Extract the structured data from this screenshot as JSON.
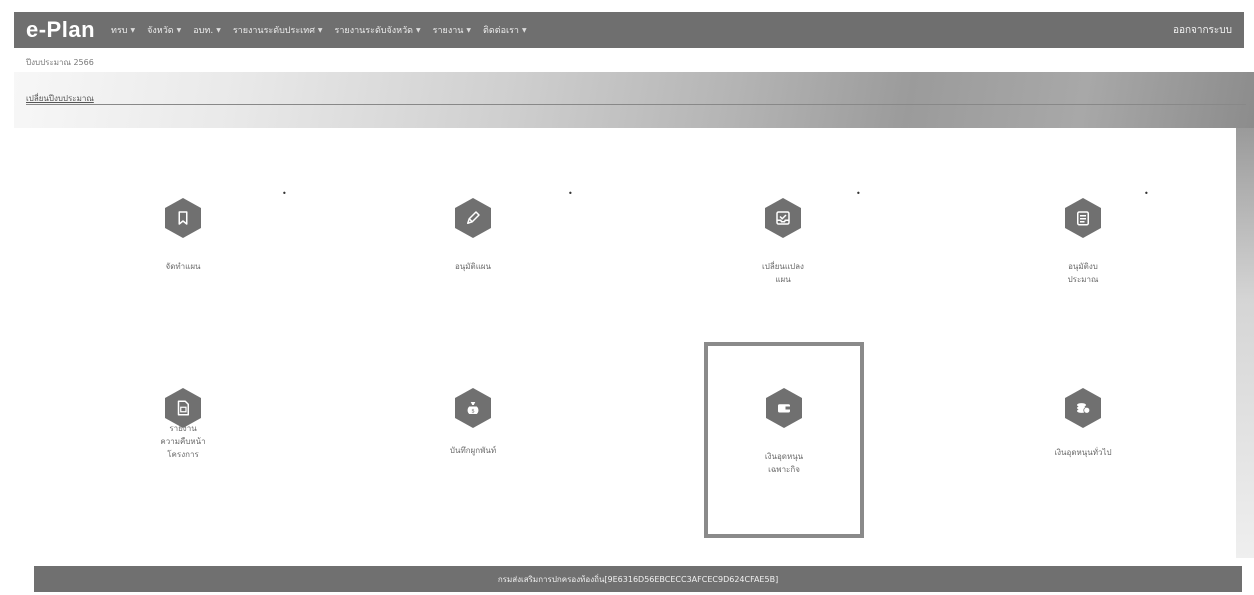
{
  "navbar": {
    "brand": "e-Plan",
    "menu": [
      {
        "label": "ทรบ"
      },
      {
        "label": "จังหวัด"
      },
      {
        "label": "อบท."
      },
      {
        "label": "รายงานระดับประเทศ"
      },
      {
        "label": "รายงานระดับจังหวัด"
      },
      {
        "label": "รายงาน"
      },
      {
        "label": "ติดต่อเรา"
      }
    ],
    "logout": "ออกจากระบบ"
  },
  "header": {
    "fiscal_year": "ปีงบประมาณ 2566",
    "change_year_link": "เปลี่ยนปีงบประมาณ"
  },
  "tiles": [
    {
      "label": "จัดทำแผน",
      "icon": "bookmark-icon"
    },
    {
      "label": "อนุมัติแผน",
      "icon": "pencil-icon"
    },
    {
      "label": "เปลี่ยนแปลง\nแผน",
      "icon": "inbox-check-icon"
    },
    {
      "label": "อนุมัติงบ\nประมาณ",
      "icon": "clipboard-icon"
    },
    {
      "label": "รายงาน\nความคืบหน้า\nโครงการ",
      "icon": "report-icon"
    },
    {
      "label": "บันทึกผูกพันท์",
      "icon": "money-bag-icon"
    },
    {
      "label": "เงินอุดหนุน\nเฉพาะกิจ",
      "icon": "wallet-icon"
    },
    {
      "label": "เงินอุดหนุนทั่วไป",
      "icon": "coins-icon"
    }
  ],
  "footer": {
    "text": "กรมส่งเสริมการปกครองท้องถิ่น[9E6316D56EBCECC3AFCEC9D624CFAE5B]"
  },
  "colors": {
    "navbar": "#6f6f6f",
    "icon_hex": "#707070",
    "footer": "#707070"
  }
}
